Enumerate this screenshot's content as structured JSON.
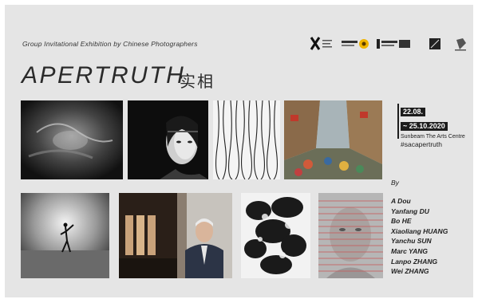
{
  "poster": {
    "subtitle": "Group Invitational Exhibition by Chinese Photographers",
    "title": "APERTRUTH",
    "title_cn": "实相",
    "dates": {
      "start": "22.08.",
      "end": "~ 25.10.2020"
    },
    "venue": "Sunbeam The Arts Centre",
    "hashtag": "#sacapertruth",
    "by_label": "By",
    "artists": [
      "A Dou",
      "Yanfang DU",
      "Bo HE",
      "Xiaoliang HUANG",
      "Yanchu SUN",
      "Marc YANG",
      "Lanpo ZHANG",
      "Wei ZHANG"
    ],
    "logos": [
      "x-logo",
      "partner-logo",
      "sunflower-logo",
      "gallery-logo",
      "square-logo",
      "bird-logo"
    ]
  }
}
